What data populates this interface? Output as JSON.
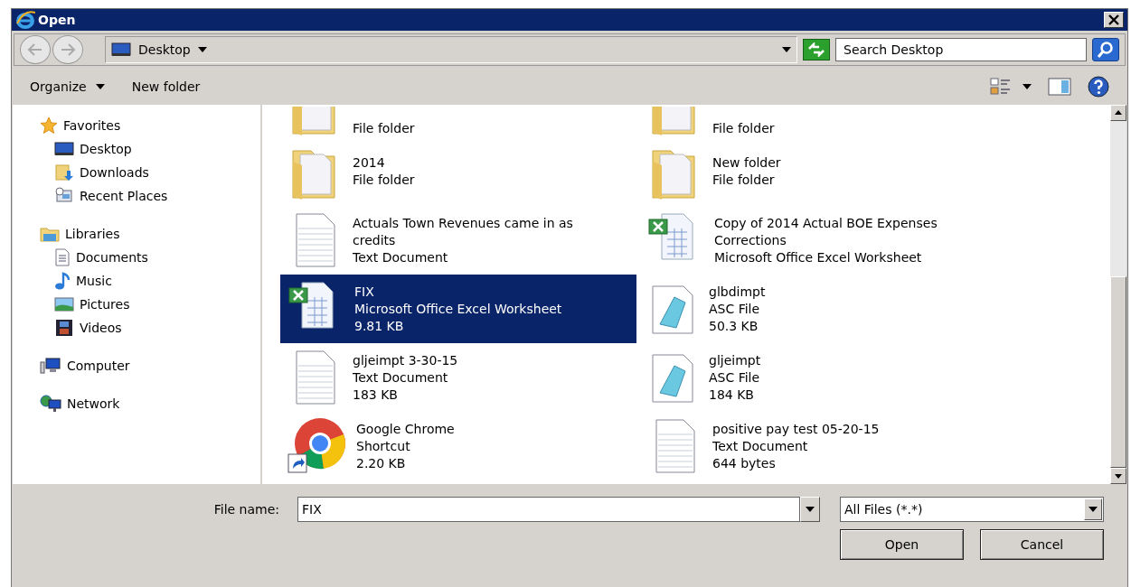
{
  "window": {
    "title": "Open"
  },
  "address": {
    "location": "Desktop"
  },
  "search": {
    "placeholder": "Search Desktop"
  },
  "toolbar": {
    "organize": "Organize",
    "new_folder": "New folder"
  },
  "sidebar": {
    "groups": [
      {
        "label": "Favorites",
        "kind": "favorites",
        "items": [
          {
            "label": "Desktop",
            "kind": "desktop"
          },
          {
            "label": "Downloads",
            "kind": "downloads"
          },
          {
            "label": "Recent Places",
            "kind": "recent"
          }
        ]
      },
      {
        "label": "Libraries",
        "kind": "libraries",
        "items": [
          {
            "label": "Documents",
            "kind": "documents"
          },
          {
            "label": "Music",
            "kind": "music"
          },
          {
            "label": "Pictures",
            "kind": "pictures"
          },
          {
            "label": "Videos",
            "kind": "videos"
          }
        ]
      },
      {
        "label": "Computer",
        "kind": "computer"
      },
      {
        "label": "Network",
        "kind": "network"
      }
    ]
  },
  "files": [
    {
      "kind": "folder",
      "lines": [
        "File folder"
      ],
      "selected": false
    },
    {
      "kind": "folder",
      "lines": [
        "File folder"
      ],
      "selected": false
    },
    {
      "kind": "folder",
      "lines": [
        "2014",
        "File folder"
      ],
      "selected": false
    },
    {
      "kind": "folder",
      "lines": [
        "New folder",
        "File folder"
      ],
      "selected": false
    },
    {
      "kind": "text",
      "lines": [
        "Actuals Town Revenues came in as credits",
        "Text Document"
      ],
      "selected": false
    },
    {
      "kind": "excel",
      "lines": [
        "Copy of 2014 Actual BOE Expenses Corrections",
        "Microsoft Office Excel Worksheet"
      ],
      "selected": false
    },
    {
      "kind": "excel",
      "lines": [
        "FIX",
        "Microsoft Office Excel Worksheet",
        "9.81 KB"
      ],
      "selected": true
    },
    {
      "kind": "asc",
      "lines": [
        "glbdimpt",
        "ASC File",
        "50.3 KB"
      ],
      "selected": false
    },
    {
      "kind": "text",
      "lines": [
        "gljeimpt 3-30-15",
        "Text Document",
        "183 KB"
      ],
      "selected": false
    },
    {
      "kind": "asc",
      "lines": [
        "gljeimpt",
        "ASC File",
        "184 KB"
      ],
      "selected": false
    },
    {
      "kind": "shortcut",
      "lines": [
        "Google Chrome",
        "Shortcut",
        "2.20 KB"
      ],
      "selected": false
    },
    {
      "kind": "text",
      "lines": [
        "positive pay test 05-20-15",
        "Text Document",
        "644 bytes"
      ],
      "selected": false
    }
  ],
  "file_name": {
    "label": "File name:",
    "value": "FIX"
  },
  "file_type": {
    "value": "All Files (*.*)"
  },
  "buttons": [
    "Open",
    "Cancel"
  ]
}
